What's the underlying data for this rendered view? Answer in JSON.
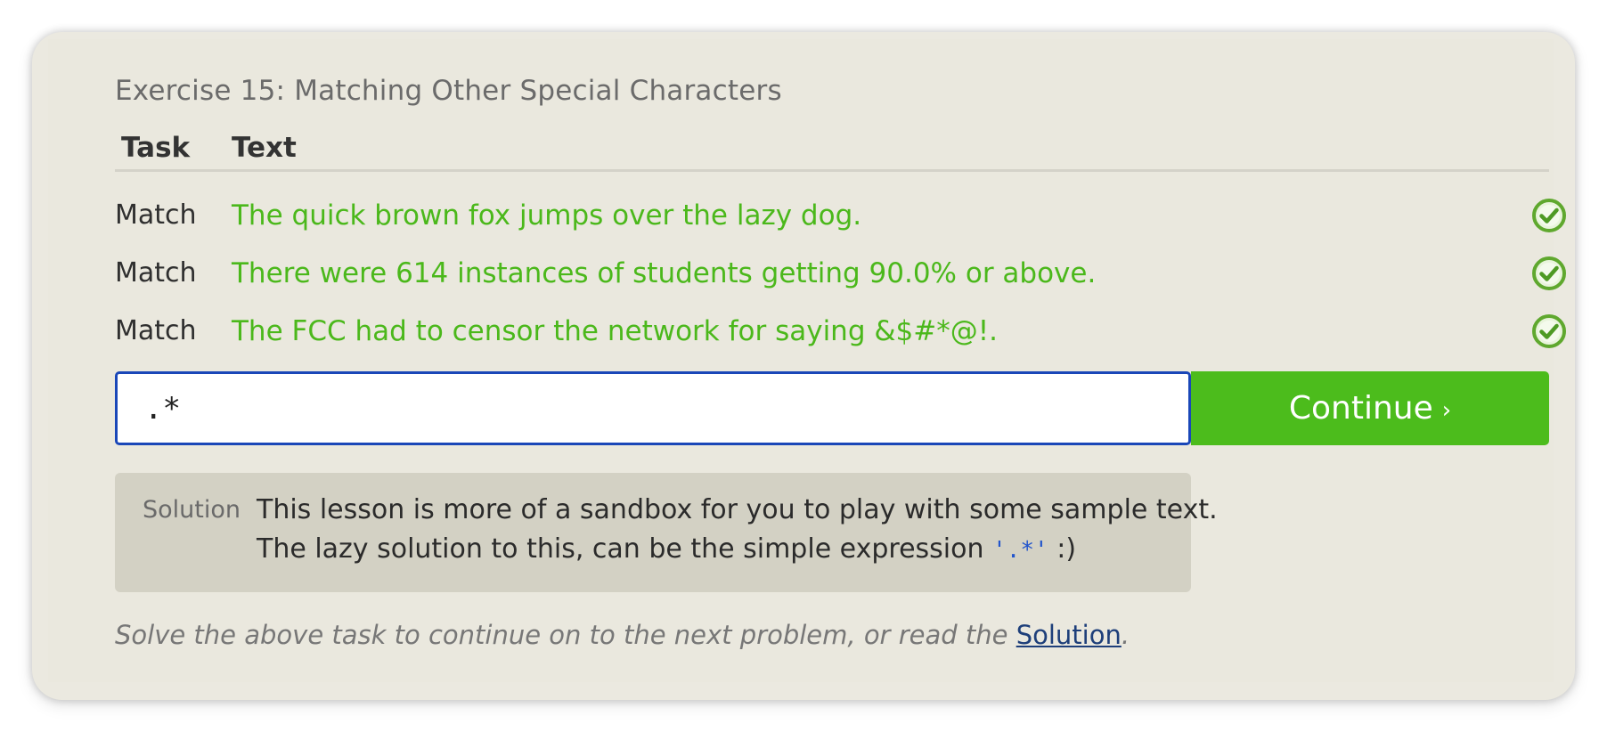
{
  "exercise": {
    "title": "Exercise 15: Matching Other Special Characters"
  },
  "table": {
    "headers": {
      "task": "Task",
      "text": "Text"
    },
    "rows": [
      {
        "task": "Match",
        "text": "The quick brown fox jumps over the lazy dog.",
        "status_icon": "check-circle-icon"
      },
      {
        "task": "Match",
        "text": "There were 614 instances of students getting 90.0% or above.",
        "status_icon": "check-circle-icon"
      },
      {
        "task": "Match",
        "text": "The FCC had to censor the network for saying &$#*@!.",
        "status_icon": "check-circle-icon"
      }
    ]
  },
  "input": {
    "value": ".*"
  },
  "continue_button": {
    "label": "Continue",
    "arrow": "›"
  },
  "solution": {
    "label": "Solution",
    "line1": "This lesson is more of a sandbox for you to play with some sample text.",
    "line2_prefix": "The lazy solution to this, can be the simple expression",
    "line2_code": "'.*'",
    "line2_suffix": ":)"
  },
  "footer": {
    "text": "Solve the above task to continue on to the next problem, or read the",
    "link": "Solution",
    "end": "."
  },
  "colors": {
    "match_text": "#4bb81b",
    "continue_bg": "#4cbc1c",
    "input_border": "#1a47b8",
    "solution_bg": "#d3d1c4",
    "panel_bg": "#eae8de"
  }
}
